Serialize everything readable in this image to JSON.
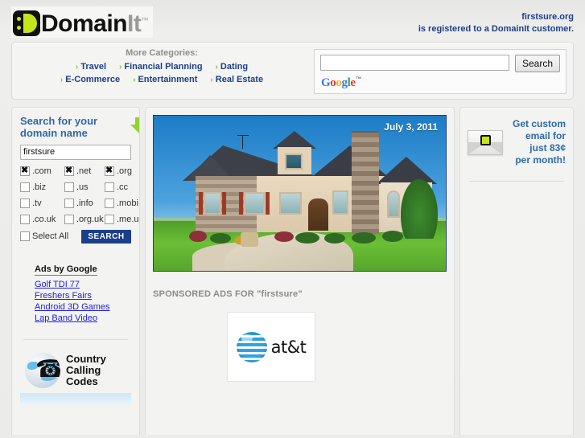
{
  "header": {
    "logo": {
      "text_dark": "Domain",
      "text_gray": "It",
      "tm": "™",
      "icon": "domainit-logo-icon"
    },
    "registration_line1": "firstsure.org",
    "registration_line2": "is registered to a DomainIt customer."
  },
  "topbar": {
    "categories_title": "More Categories:",
    "bullet": "›",
    "categories": [
      "Travel",
      "Financial Planning",
      "Dating",
      "E-Commerce",
      "Entertainment",
      "Real Estate"
    ],
    "google": {
      "query_value": "",
      "placeholder": "",
      "search_button": "Search",
      "logo": {
        "g": "G",
        "o1": "o",
        "o2": "o",
        "g2": "g",
        "l": "l",
        "e": "e",
        "tm": "™"
      }
    }
  },
  "sidebar": {
    "title": "Search for your domain name",
    "arrow_icon": "green-down-arrow-icon",
    "domain_input_value": "firstsure",
    "domain_input_placeholder": "",
    "tlds": [
      {
        "label": ".com",
        "checked": true
      },
      {
        "label": ".net",
        "checked": true
      },
      {
        "label": ".org",
        "checked": true
      },
      {
        "label": ".biz",
        "checked": false
      },
      {
        "label": ".us",
        "checked": false
      },
      {
        "label": ".cc",
        "checked": false
      },
      {
        "label": ".tv",
        "checked": false
      },
      {
        "label": ".info",
        "checked": false
      },
      {
        "label": ".mobi",
        "checked": false
      },
      {
        "label": ".co.uk",
        "checked": false
      },
      {
        "label": ".org.uk",
        "checked": false
      },
      {
        "label": ".me.uk",
        "checked": false
      }
    ],
    "select_all_label": "Select All",
    "select_all_checked": false,
    "search_button": "SEARCH",
    "ads": {
      "title": "Ads by Google",
      "links": [
        "Golf TDI 77",
        "Freshers Fairs",
        "Android 3D Games",
        "Lap Band Video"
      ]
    },
    "banner": {
      "line1": "Country",
      "line2": "Calling",
      "line3": "Codes",
      "icon": "globe-phone-icon"
    }
  },
  "main": {
    "hero": {
      "date": "July 3, 2011",
      "image": "house-photo"
    },
    "sponsored_title": "SPONSORED ADS FOR \"firstsure\"",
    "ad": {
      "brand": "at&t",
      "logo_icon": "att-globe-icon"
    }
  },
  "right": {
    "promo_line1": "Get custom",
    "promo_line2": "email for",
    "promo_line3": "just 83¢",
    "promo_line4": "per month!",
    "envelope_icon": "envelope-icon"
  },
  "colors": {
    "brand_blue": "#1b3f8b",
    "heading_blue": "#2f6aa8",
    "accent_green": "#c4e619",
    "arrow_green": "#93d331",
    "link_blue": "#2020dd",
    "page_bg": "#ebebe9"
  }
}
